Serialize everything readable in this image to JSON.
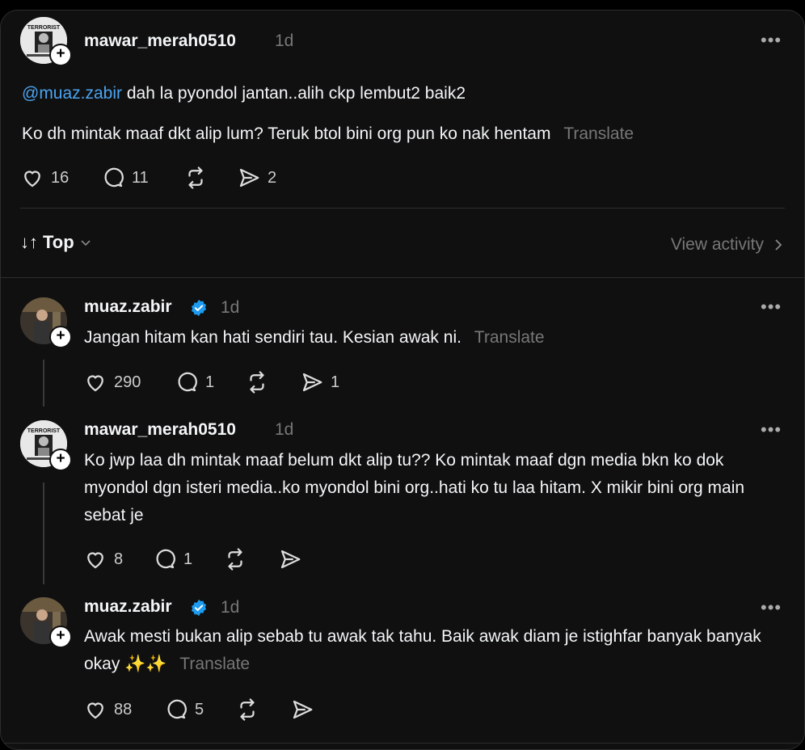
{
  "post": {
    "username": "mawar_merah0510",
    "time": "1d",
    "mention": "@muaz.zabir",
    "line1": "dah la pyondol jantan..alih ckp lembut2 baik2",
    "line2": "Ko dh mintak maaf dkt alip lum? Teruk btol bini org pun ko nak hentam",
    "translate": "Translate",
    "likes": "16",
    "replies": "11",
    "shares": "2",
    "avatar_text": "TERRORIST"
  },
  "sort": {
    "label": "Top",
    "view_activity": "View activity"
  },
  "replies": [
    {
      "username": "muaz.zabir",
      "verified": true,
      "time": "1d",
      "text": "Jangan hitam kan hati sendiri tau. Kesian awak ni.",
      "translate": "Translate",
      "likes": "290",
      "replies": "1",
      "shares": "1"
    },
    {
      "username": "mawar_merah0510",
      "verified": false,
      "time": "1d",
      "text": "Ko jwp laa dh mintak maaf belum dkt alip tu?? Ko mintak maaf dgn media bkn ko dok myondol dgn isteri media..ko myondol bini org..hati ko tu laa hitam. X mikir bini org main sebat je",
      "likes": "8",
      "replies": "1",
      "shares": ""
    },
    {
      "username": "muaz.zabir",
      "verified": true,
      "time": "1d",
      "text": "Awak mesti bukan alip sebab tu awak tak tahu. Baik awak diam je istighfar banyak banyak okay ✨✨",
      "translate": "Translate",
      "likes": "88",
      "replies": "5",
      "shares": ""
    }
  ]
}
